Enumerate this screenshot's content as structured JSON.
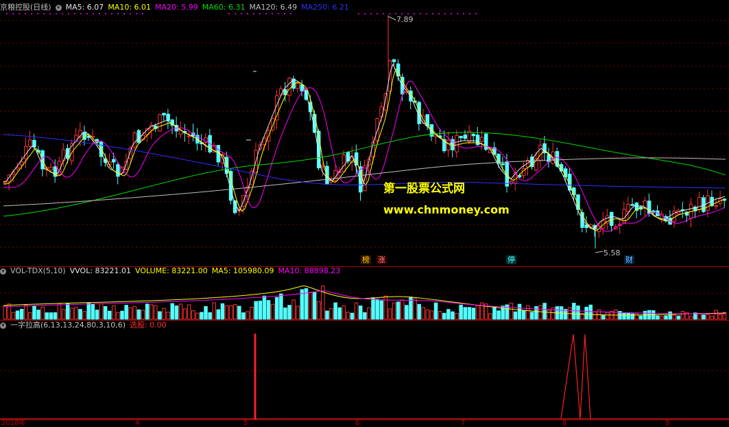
{
  "colors": {
    "up": "#ff3232",
    "down": "#54ffff",
    "ma5": "#e8e8e8",
    "ma10": "#ffff00",
    "ma20": "#ff00ff",
    "ma60": "#00dd00",
    "ma120": "#c0c0c0",
    "ma250": "#3030ff",
    "grid": "#800000",
    "signal": "#ff2020"
  },
  "main_header": {
    "title": "京粮控股(日线)",
    "ma5": "MA5: 6.07",
    "ma10": "MA10: 6.01",
    "ma20": "MA20: 5.99",
    "ma60": "MA60: 6.31",
    "ma120": "MA120: 6.49",
    "ma250": "MA250: 6.21"
  },
  "price_labels": {
    "high": "7.89",
    "low": "5.58"
  },
  "tags": {
    "bang": "榜",
    "zhang": "涨",
    "ting": "停",
    "cai": "财"
  },
  "watermark": {
    "line1": "第一股票公式网",
    "line2": "www.chnmoney.com"
  },
  "vol_header": {
    "name": "VOL-TDX(5,10)",
    "vvol": "VVOL: 83221.01",
    "volume": "VOLUME: 83221.00",
    "ma5": "MA5: 105980.09",
    "ma10": "MA10: 88898.23"
  },
  "ind_header": {
    "name": "一字拉高(6,13,13,24,80,3,10,6)",
    "signal": "选股: 0.00"
  },
  "bottom_axis": [
    "2018年",
    "4",
    "5",
    "6",
    "7",
    "8",
    "9"
  ],
  "chart_data": {
    "type": "candlestick",
    "price_range": [
      5.2,
      8.0
    ],
    "series": [
      {
        "name": "MA5",
        "last": 6.07
      },
      {
        "name": "MA10",
        "last": 6.01
      },
      {
        "name": "MA20",
        "last": 5.99
      },
      {
        "name": "MA60",
        "last": 6.31
      },
      {
        "name": "MA120",
        "last": 6.49
      },
      {
        "name": "MA250",
        "last": 6.21
      }
    ],
    "max_price": 7.89,
    "min_price": 5.58,
    "volume_last": 83221.0,
    "volume_ma5": 105980.09,
    "volume_ma10": 88898.23
  }
}
